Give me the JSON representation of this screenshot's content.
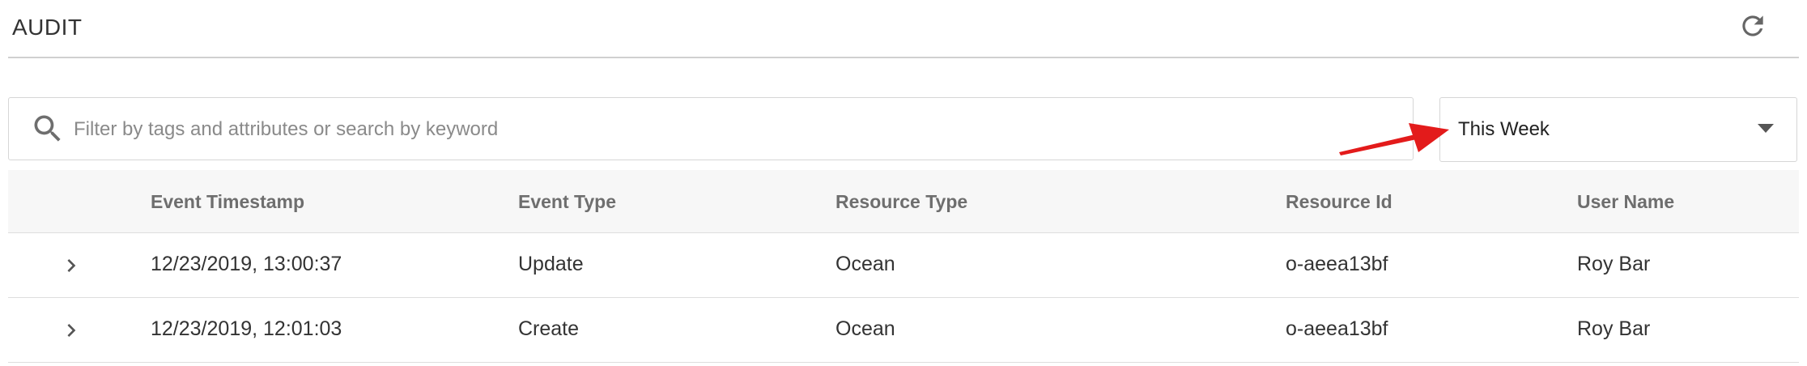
{
  "header": {
    "title": "AUDIT",
    "refresh_icon": "refresh-icon"
  },
  "search": {
    "placeholder": "Filter by tags and attributes or search by keyword",
    "value": "",
    "icon": "search-icon"
  },
  "period_select": {
    "selected": "This Week",
    "icon": "caret-down-icon"
  },
  "annotation": {
    "color": "#e31b1b"
  },
  "table": {
    "columns": [
      "Event Timestamp",
      "Event Type",
      "Resource Type",
      "Resource Id",
      "User Name"
    ],
    "rows": [
      {
        "timestamp": "12/23/2019, 13:00:37",
        "event_type": "Update",
        "resource_type": "Ocean",
        "resource_id": "o-aeea13bf",
        "user_name": "Roy Bar"
      },
      {
        "timestamp": "12/23/2019, 12:01:03",
        "event_type": "Create",
        "resource_type": "Ocean",
        "resource_id": "o-aeea13bf",
        "user_name": "Roy Bar"
      }
    ]
  }
}
